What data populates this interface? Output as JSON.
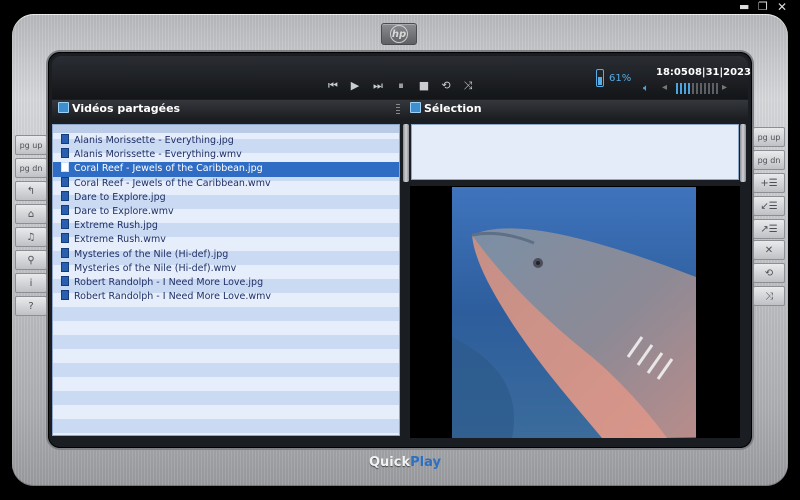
{
  "window": {
    "minimize_glyph": "▬",
    "maximize_glyph": "❐",
    "close_glyph": "✕"
  },
  "brand": {
    "logo_text": "hp"
  },
  "transport": {
    "prev_icon": "⏮",
    "play_icon": "▶",
    "next_icon": "⏭",
    "pause_icon": "⏸",
    "stop_icon": "■",
    "repeat_icon": "⟲",
    "shuffle_icon": "⤨"
  },
  "status": {
    "battery_pct": "61%",
    "time": "18:05",
    "date": "08|31|2023",
    "volume_level": 0.35
  },
  "left_panel": {
    "title": "Vidéos partagées",
    "files": [
      "Alanis Morissette - Everything.jpg",
      "Alanis Morissette - Everything.wmv",
      "Coral Reef - Jewels of the Caribbean.jpg",
      "Coral Reef - Jewels of the Caribbean.wmv",
      "Dare to Explore.jpg",
      "Dare to Explore.wmv",
      "Extreme Rush.jpg",
      "Extreme Rush.wmv",
      "Mysteries of the Nile (Hi-def).jpg",
      "Mysteries of the Nile (Hi-def).wmv",
      "Robert Randolph - I Need More Love.jpg",
      "Robert Randolph - I Need More Love.wmv"
    ],
    "selected_index": 2
  },
  "right_panel": {
    "title": "Sélection"
  },
  "side_left": {
    "pg_up": "pg up",
    "pg_dn": "pg dn",
    "back_icon": "↰",
    "home_icon": "⌂",
    "music_icon": "♫",
    "search_icon": "⚲",
    "info_icon": "i",
    "help_icon": "?"
  },
  "side_right": {
    "pg_up": "pg up",
    "pg_dn": "pg dn",
    "add_icon": "+☰",
    "import_icon": "↙☰",
    "export_icon": "↗☰",
    "remove_icon": "✕",
    "repeat_icon": "⟲",
    "shuffle_icon": "⤨"
  },
  "footer": {
    "quick": "Quick",
    "play": "Play"
  }
}
